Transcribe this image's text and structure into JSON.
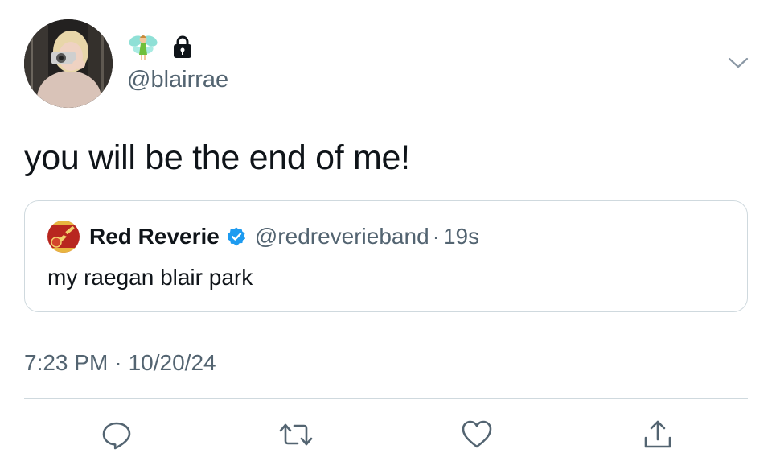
{
  "author": {
    "display_name_emoji": "fairy-emoji",
    "protected_icon": "lock-icon",
    "handle": "@blairrae"
  },
  "tweet": {
    "text": "you will be the end of me!",
    "timestamp_time": "7:23 PM",
    "separator": "·",
    "timestamp_date": "10/20/24"
  },
  "quote": {
    "name": "Red Reverie",
    "verified_icon": "verified-badge-icon",
    "handle": "@redreverieband",
    "separator": "·",
    "time": "19s",
    "text": "my raegan blair park"
  },
  "actions": [
    "reply-icon",
    "retweet-icon",
    "like-icon",
    "share-icon"
  ],
  "colors": {
    "text": "#0f1419",
    "secondary": "#536471",
    "border": "#cfd9de",
    "verified": "#1d9bf0"
  }
}
